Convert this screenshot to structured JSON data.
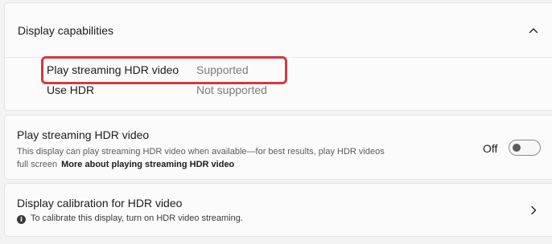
{
  "capabilities": {
    "title": "Display capabilities",
    "rows": [
      {
        "label": "Play streaming HDR video",
        "value": "Supported"
      },
      {
        "label": "Use HDR",
        "value": "Not supported"
      }
    ]
  },
  "streaming": {
    "title": "Play streaming HDR video",
    "description": "This display can play streaming HDR video when available—for best results, play HDR videos full screen",
    "link_text": "More about playing streaming HDR video",
    "toggle_label": "Off",
    "toggle_on": false
  },
  "calibration": {
    "title": "Display calibration for HDR video",
    "note": "To calibrate this display, turn on HDR video streaming.",
    "info_icon": "i"
  },
  "colors": {
    "highlight": "#d23a3f",
    "background": "#f3f3f3",
    "card": "#fbfbfb"
  }
}
